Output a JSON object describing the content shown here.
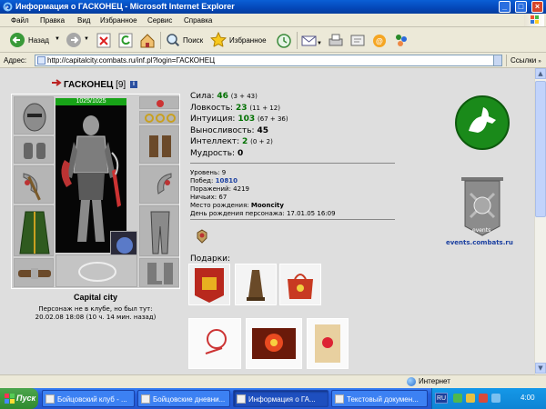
{
  "window": {
    "title": "Информация о ГАСКОНЕЦ - Microsoft Internet Explorer"
  },
  "menu": [
    "Файл",
    "Правка",
    "Вид",
    "Избранное",
    "Сервис",
    "Справка"
  ],
  "toolbar": {
    "back": "Назад",
    "search": "Поиск",
    "favorites": "Избранное"
  },
  "address": {
    "label": "Адрес:",
    "url": "http://capitalcity.combats.ru/inf.pl?login=ГАСКОНЕЦ",
    "links": "Ссылки"
  },
  "character": {
    "name": "ГАСКОНЕЦ",
    "level_badge": "[9]",
    "info_icon": "i",
    "hp": "1025/1025",
    "city": "Capital city",
    "last_seen_1": "Персонаж не в клубе, но был тут:",
    "last_seen_2": "20.02.08 18:08 (10 ч. 14 мин. назад)"
  },
  "stats": [
    {
      "label": "Сила:",
      "value": "46",
      "extra": "(3 + 43)",
      "style": "green"
    },
    {
      "label": "Ловкость:",
      "value": "23",
      "extra": "(11 + 12)",
      "style": "green"
    },
    {
      "label": "Интуиция:",
      "value": "103",
      "extra": "(67 + 36)",
      "style": "green"
    },
    {
      "label": "Выносливость:",
      "value": "45",
      "extra": "",
      "style": "black"
    },
    {
      "label": "Интеллект:",
      "value": "2",
      "extra": "(0 + 2)",
      "style": "green"
    },
    {
      "label": "Мудрость:",
      "value": "0",
      "extra": "",
      "style": "black"
    }
  ],
  "info": {
    "level_label": "Уровень:",
    "level": "9",
    "wins_label": "Побед:",
    "wins": "10810",
    "losses_label": "Поражений:",
    "losses": "4219",
    "draws_label": "Ничьих:",
    "draws": "67",
    "birthplace_label": "Место рождения:",
    "birthplace": "Mooncity",
    "birthday_label": "День рождения персонажа:",
    "birthday": "17.01.05 16:09"
  },
  "gifts_label": "Подарки:",
  "events_link": "events.combats.ru",
  "banner_text": "events",
  "status": {
    "zone": "Интернет"
  },
  "taskbar": {
    "start": "Пуск",
    "tasks": [
      "Бойцовский клуб - ...",
      "Бойцовские дневни...",
      "Информация о ГА...",
      "Текстовый докумен..."
    ],
    "lang": "RU",
    "clock": "4:00"
  },
  "colors": {
    "stat_green": "#007000",
    "info_blue": "#1a3fa0",
    "emblem_green": "#1a8a1a",
    "hp_green": "#17a317"
  }
}
